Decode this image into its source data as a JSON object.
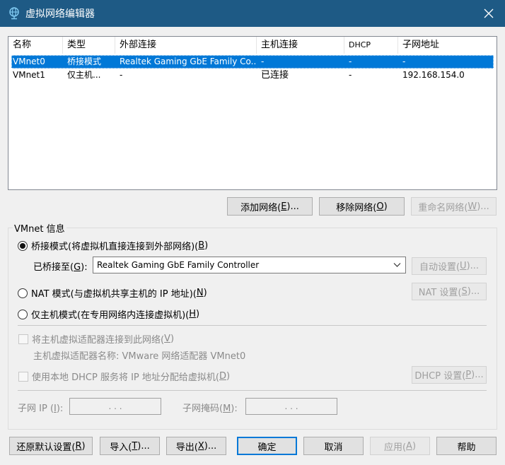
{
  "window": {
    "title": "虚拟网络编辑器"
  },
  "table": {
    "headers": [
      "名称",
      "类型",
      "外部连接",
      "主机连接",
      "DHCP",
      "子网地址"
    ],
    "rows": [
      {
        "name": "VMnet0",
        "type": "桥接模式",
        "external": "Realtek Gaming GbE Family Co...",
        "host": "-",
        "dhcp": "-",
        "subnet": "-"
      },
      {
        "name": "VMnet1",
        "type": "仅主机...",
        "external": "-",
        "host": "已连接",
        "dhcp": "-",
        "subnet": "192.168.154.0"
      }
    ]
  },
  "list_buttons": {
    "add": {
      "text": "添加网络(",
      "key": "E",
      "suffix": ")..."
    },
    "remove": {
      "text": "移除网络(",
      "key": "O",
      "suffix": ")"
    },
    "rename": {
      "text": "重命名网络(",
      "key": "W",
      "suffix": ")..."
    }
  },
  "vmnet_info": {
    "legend": "VMnet 信息",
    "bridged": {
      "text": "桥接模式(将虚拟机直接连接到外部网络)(",
      "key": "B",
      "suffix": ")"
    },
    "bridged_to": {
      "text": "已桥接至(",
      "key": "G",
      "suffix": "):"
    },
    "bridged_adapter": "Realtek Gaming GbE Family Controller",
    "auto_settings": {
      "text": "自动设置(",
      "key": "U",
      "suffix": ")..."
    },
    "nat": {
      "text": "NAT 模式(与虚拟机共享主机的 IP 地址)(",
      "key": "N",
      "suffix": ")"
    },
    "nat_settings": {
      "text": "NAT 设置(",
      "key": "S",
      "suffix": ")..."
    },
    "host_only": {
      "text": "仅主机模式(在专用网络内连接虚拟机)(",
      "key": "H",
      "suffix": ")"
    },
    "connect_adapter": {
      "text": "将主机虚拟适配器连接到此网络(",
      "key": "V",
      "suffix": ")"
    },
    "adapter_name": "主机虚拟适配器名称: VMware 网络适配器 VMnet0",
    "dhcp_check": {
      "text": "使用本地 DHCP 服务将 IP 地址分配给虚拟机(",
      "key": "D",
      "suffix": ")"
    },
    "dhcp_settings": {
      "text": "DHCP 设置(",
      "key": "P",
      "suffix": ")..."
    },
    "subnet_ip": {
      "text": "子网 IP (",
      "key": "I",
      "suffix": "):"
    },
    "subnet_mask": {
      "text": "子网掩码(",
      "key": "M",
      "suffix": "):"
    },
    "ip_dots": ".      .      ."
  },
  "footer": {
    "restore": {
      "text": "还原默认设置(",
      "key": "R",
      "suffix": ")"
    },
    "import": {
      "text": "导入(",
      "key": "T",
      "suffix": ")..."
    },
    "export": {
      "text": "导出(",
      "key": "X",
      "suffix": ")..."
    },
    "ok": "确定",
    "cancel": "取消",
    "apply": {
      "text": "应用(",
      "key": "A",
      "suffix": ")"
    },
    "help": "帮助"
  },
  "colors": {
    "titlebar": "#1e5a85",
    "selection": "#0078d7",
    "dialog": "#f0f0f0"
  },
  "icons": {
    "app": "network-globe-icon",
    "close": "close-icon",
    "dropdown": "chevron-down-icon"
  }
}
